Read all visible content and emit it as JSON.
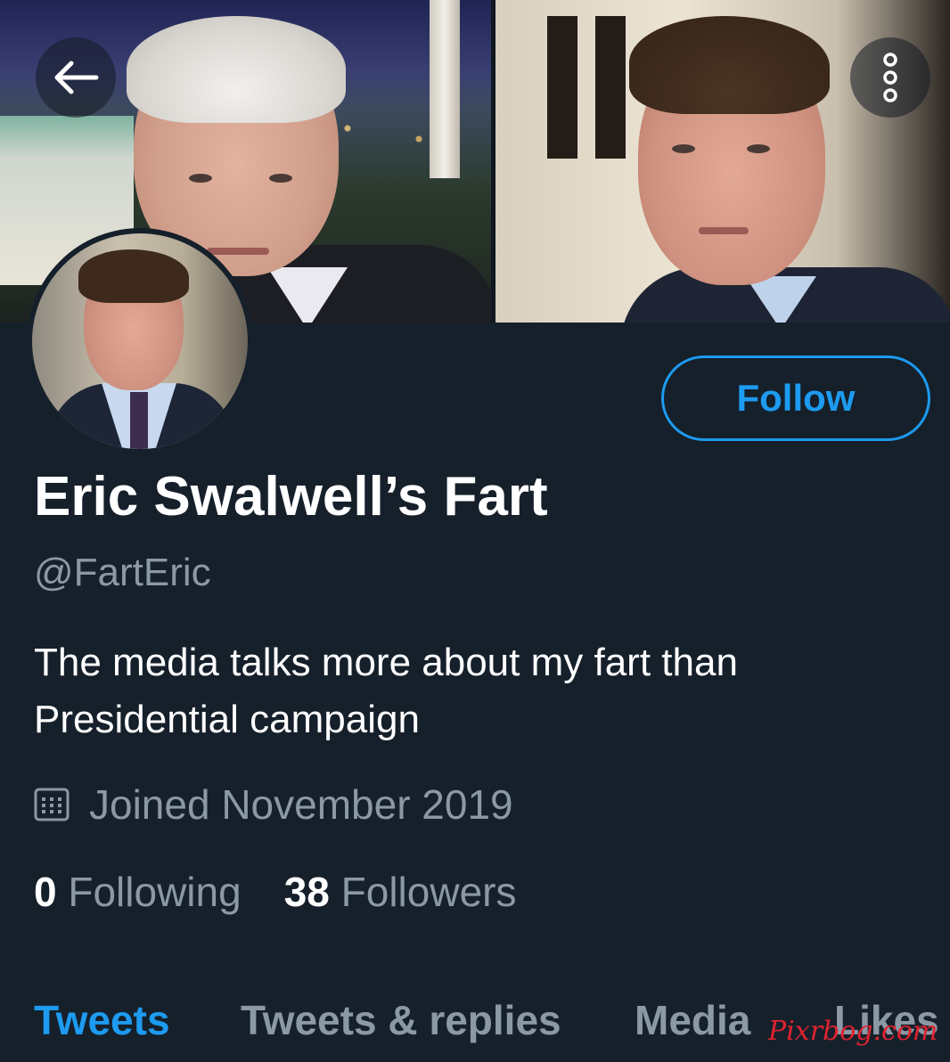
{
  "header": {
    "back_icon": "arrow-left-icon",
    "more_icon": "more-vertical-icon"
  },
  "profile": {
    "follow_label": "Follow",
    "display_name": "Eric Swalwell’s Fart",
    "handle": "@FartEric",
    "bio": "The media talks more about my fart than Presidential campaign",
    "joined_icon": "calendar-icon",
    "joined": "Joined November 2019",
    "following_count": "0",
    "following_label": "Following",
    "followers_count": "38",
    "followers_label": "Followers"
  },
  "tabs": [
    {
      "label": "Tweets",
      "active": true
    },
    {
      "label": "Tweets & replies",
      "active": false
    },
    {
      "label": "Media",
      "active": false
    },
    {
      "label": "Likes",
      "active": false
    }
  ],
  "watermark": "Pixrbog.com",
  "colors": {
    "background": "#15202b",
    "accent": "#1d9bf0",
    "secondary_text": "#8b98a5"
  }
}
